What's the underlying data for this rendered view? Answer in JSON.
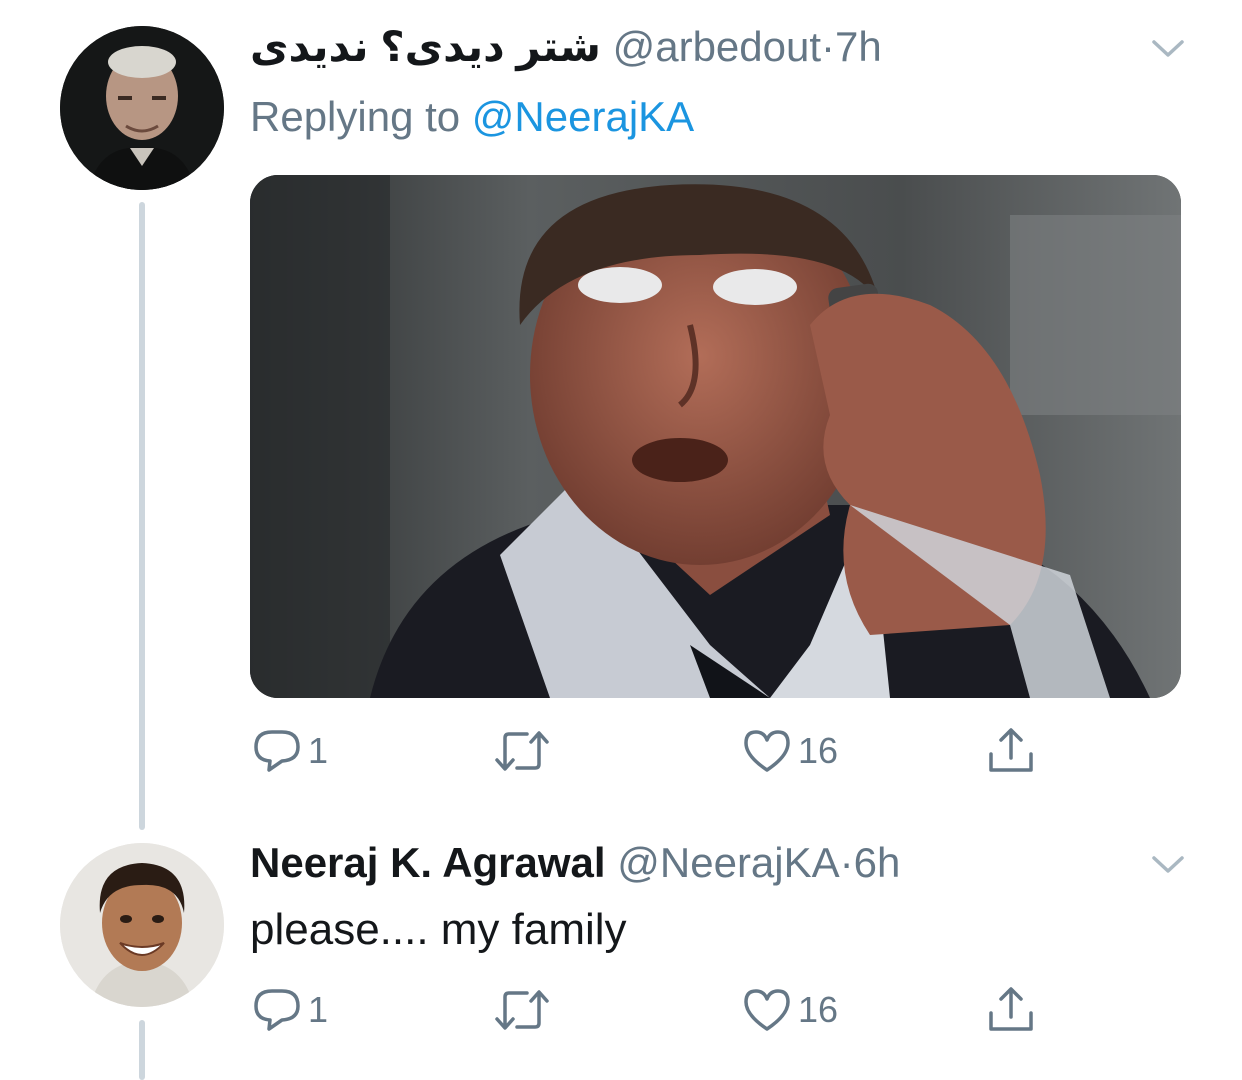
{
  "tweets": [
    {
      "display_name": "شتر دیدی؟ ندیدی",
      "handle": "@arbedout",
      "separator": "·",
      "time": "7h",
      "replying_prefix": "Replying to",
      "replying_to": "@NeerajKA",
      "avatar": "man-portrait-avatar",
      "media": "gif-man-on-phone-eyes-rolled",
      "actions": {
        "reply_count": "1",
        "retweet_count": "",
        "like_count": "16"
      }
    },
    {
      "display_name": "Neeraj K. Agrawal",
      "handle": "@NeerajKA",
      "separator": "·",
      "time": "6h",
      "text": "please.... my family",
      "avatar": "smiling-man-avatar",
      "actions": {
        "reply_count": "1",
        "retweet_count": "",
        "like_count": "16"
      }
    }
  ],
  "icons": [
    "reply-icon",
    "retweet-icon",
    "like-icon",
    "share-icon",
    "chevron-down-icon"
  ],
  "colors": {
    "accent": "#1b95e0",
    "secondary_text": "#657786",
    "thread_line": "#cdd6dd",
    "primary_text": "#14171a"
  }
}
